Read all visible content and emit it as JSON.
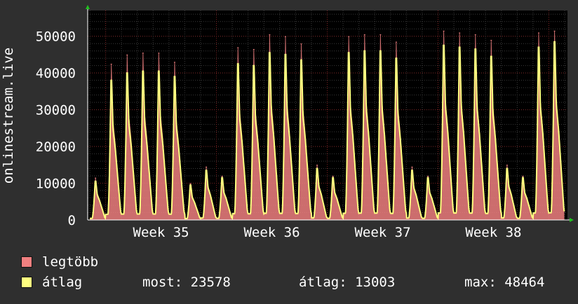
{
  "chart_data": {
    "type": "area",
    "ylabel": "onlinestream.live",
    "x_ticks": [
      "Week 35",
      "Week 36",
      "Week 37",
      "Week 38"
    ],
    "y_ticks": [
      "0",
      "10000",
      "20000",
      "30000",
      "40000",
      "50000"
    ],
    "ylim": [
      0,
      57000
    ],
    "grid": true,
    "legend_position": "bottom-left",
    "x_unit": "day",
    "series": [
      {
        "name": "legtöbb",
        "color": "#f08080",
        "values": [
          11500,
          42500,
          45000,
          45500,
          45500,
          43000,
          10000,
          14500,
          12000,
          47000,
          46500,
          50500,
          50000,
          48000,
          15000,
          12000,
          50000,
          50500,
          50500,
          48500,
          14500,
          12000,
          51500,
          51000,
          50500,
          49000,
          15000,
          12000,
          51000,
          51500
        ]
      },
      {
        "name": "átlag",
        "color": "#ffff80",
        "values": [
          10500,
          38000,
          40000,
          40500,
          40500,
          39000,
          9500,
          13500,
          11500,
          42500,
          42000,
          45500,
          45000,
          43500,
          14000,
          11500,
          45500,
          46000,
          46000,
          44000,
          13500,
          11500,
          47500,
          47000,
          46500,
          44500,
          14000,
          11500,
          47000,
          48464
        ]
      }
    ]
  },
  "legend": {
    "items": [
      {
        "label": "legtöbb",
        "color": "#f08080"
      },
      {
        "label": "átlag",
        "color": "#ffff80"
      }
    ],
    "stats": {
      "most": "most: 23578",
      "atlag": "átlag: 13003",
      "max": "max: 48464"
    }
  }
}
